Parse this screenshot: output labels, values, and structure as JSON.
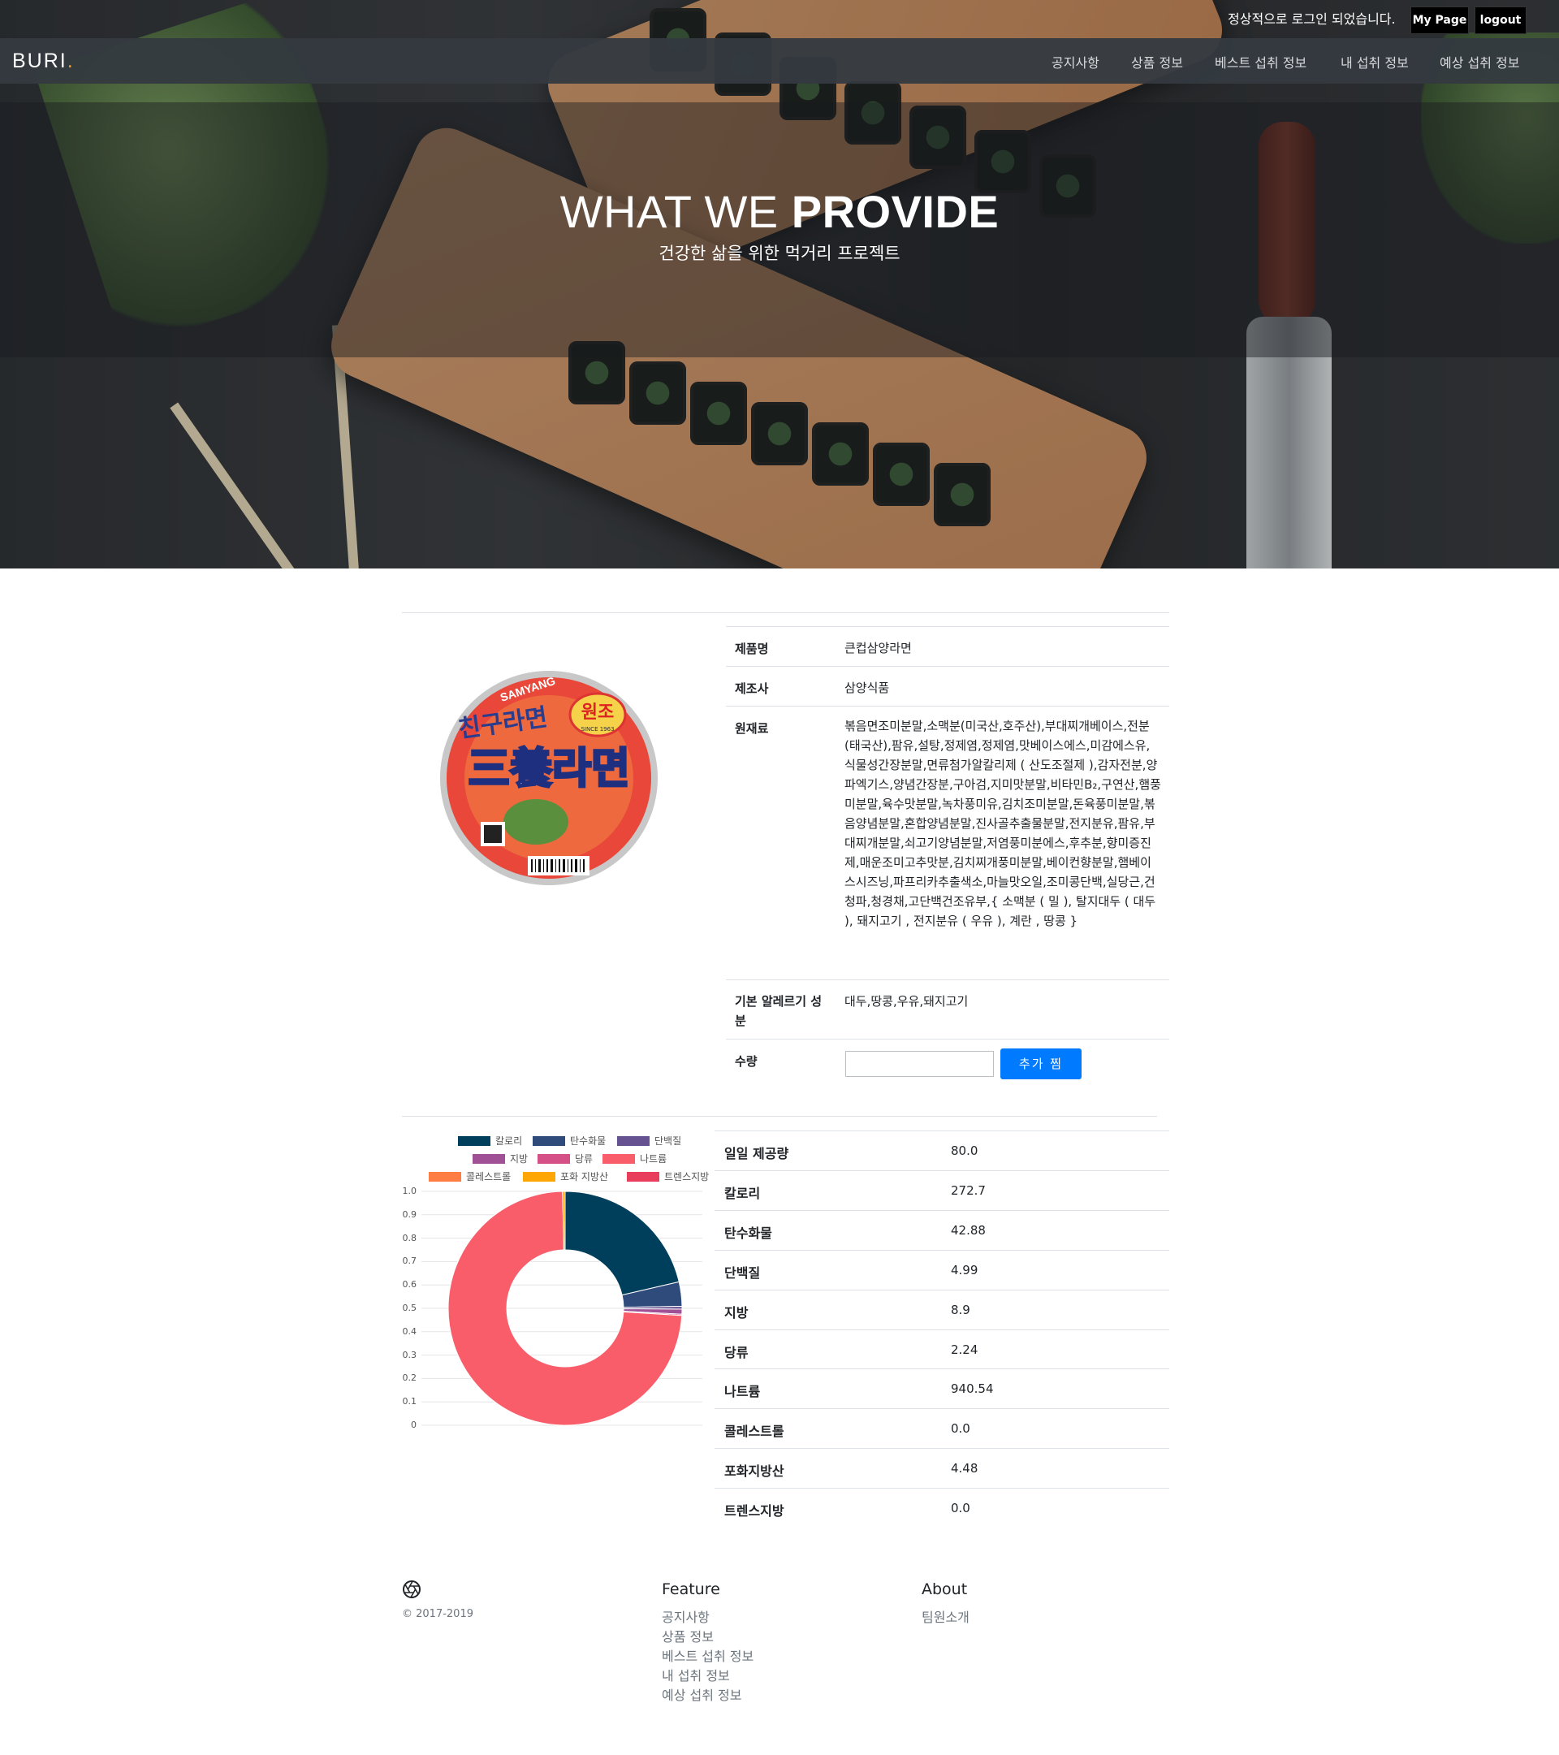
{
  "top": {
    "login_message": "정상적으로 로그인 되었습니다.",
    "mypage_label": "My Page",
    "logout_label": "logout"
  },
  "navbar": {
    "brand": "BURI",
    "brand_dot": ".",
    "items": [
      "공지사항",
      "상품 정보",
      "베스트 섭취 정보",
      "내 섭취 정보",
      "예상 섭취 정보"
    ]
  },
  "hero": {
    "title_light": "WHAT WE ",
    "title_bold": "PROVIDE",
    "subtitle": "건강한 삶을 위한 먹거리 프로젝트"
  },
  "product": {
    "rows": [
      {
        "label": "제품명",
        "value": "큰컵삼양라면"
      },
      {
        "label": "제조사",
        "value": "삼양식품"
      },
      {
        "label": "원재료",
        "value": "볶음면조미분말,소맥분(미국산,호주산),부대찌개베이스,전분(태국산),팜유,설탕,정제염,정제염,맛베이스에스,미감에스유,식물성간장분말,면류첨가알칼리제 ( 산도조절제 ),감자전분,양파엑기스,양념간장분,구아검,지미맛분말,비타민B₂,구연산,햄풍미분말,육수맛분말,녹차풍미유,김치조미분말,돈육풍미분말,볶음양념분말,혼합양념분말,진사골추출물분말,전지분유,팜유,부대찌개분말,쇠고기양념분말,저염풍미분에스,후추분,향미증진제,매운조미고추맛분,김치찌개풍미분말,베이컨향분말,햄베이스시즈닝,파프리카추출색소,마늘맛오일,조미콩단백,실당근,건청파,청경채,고단백건조유부,{ 소맥분 ( 밀 ), 탈지대두 ( 대두 ), 돼지고기 , 전지분유 ( 우유 ), 계란 , 땅콩 }"
      },
      {
        "label": "기본 알레르기 성분",
        "value": "대두,땅콩,우유,돼지고기"
      },
      {
        "label": "수량",
        "value": ""
      }
    ],
    "add_button": "추가 찜",
    "quantity_value": "",
    "image_text": {
      "brand": "SAMYANG",
      "badge": "원조",
      "badge_sub": "SINCE 1963",
      "top_line": "친구라면",
      "main": "三養라면"
    }
  },
  "nutrition": [
    {
      "label": "일일 제공량",
      "value": "80.0"
    },
    {
      "label": "칼로리",
      "value": "272.7"
    },
    {
      "label": "탄수화물",
      "value": "42.88"
    },
    {
      "label": "단백질",
      "value": "4.99"
    },
    {
      "label": "지방",
      "value": "8.9"
    },
    {
      "label": "당류",
      "value": "2.24"
    },
    {
      "label": "나트륨",
      "value": "940.54"
    },
    {
      "label": "콜레스트롤",
      "value": "0.0"
    },
    {
      "label": "포화지방산",
      "value": "4.48"
    },
    {
      "label": "트렌스지방",
      "value": "0.0"
    }
  ],
  "chart_data": {
    "type": "pie",
    "donut": true,
    "categories": [
      "칼로리",
      "탄수화물",
      "단백질",
      "지방",
      "당류",
      "나트륨",
      "콜레스트롤",
      "포화 지방산",
      "트렌스지방"
    ],
    "values": [
      272.7,
      42.88,
      4.99,
      8.9,
      2.24,
      940.54,
      0.0,
      4.48,
      0.0
    ],
    "colors": [
      "#003f5c",
      "#2f4b7c",
      "#665191",
      "#a05195",
      "#d45087",
      "#f95d6a",
      "#ff7c43",
      "#ffa600",
      "#e83e5c"
    ],
    "y_ticks": [
      "1.0",
      "0.9",
      "0.8",
      "0.7",
      "0.6",
      "0.5",
      "0.4",
      "0.3",
      "0.2",
      "0.1",
      "0"
    ],
    "legend_position": "top"
  },
  "footer": {
    "copyright": "© 2017-2019",
    "feature_title": "Feature",
    "feature_links": [
      "공지사항",
      "상품 정보",
      "베스트 섭취 정보",
      "내 섭취 정보",
      "예상 섭취 정보"
    ],
    "about_title": "About",
    "about_links": [
      "팀원소개"
    ]
  }
}
